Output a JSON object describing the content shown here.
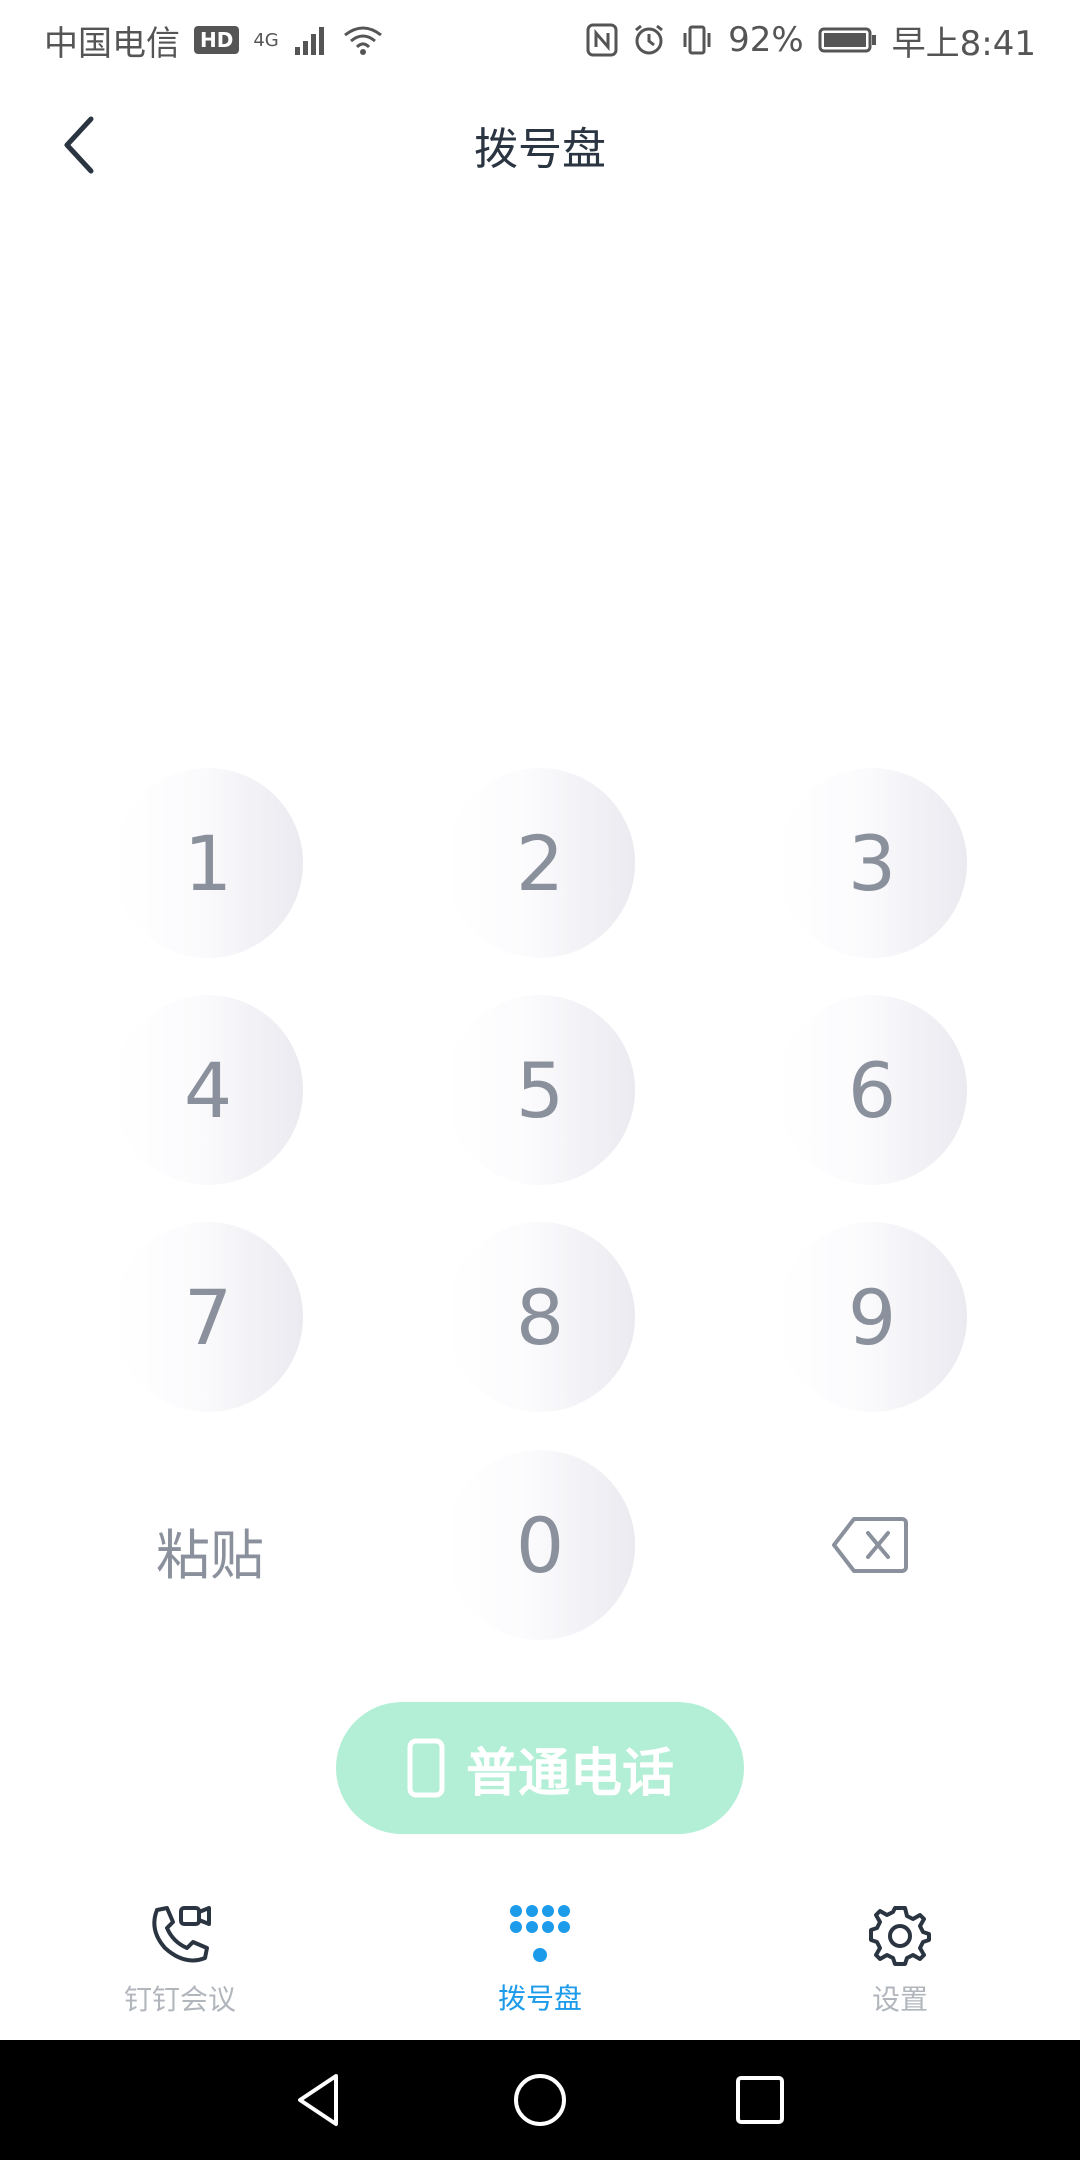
{
  "status_bar": {
    "carrier": "中国电信",
    "hd": "HD",
    "network": "4G",
    "battery": "92%",
    "time": "早上8:41"
  },
  "header": {
    "title": "拨号盘"
  },
  "keypad": {
    "keys": [
      "1",
      "2",
      "3",
      "4",
      "5",
      "6",
      "7",
      "8",
      "9",
      "0"
    ],
    "paste_label": "粘贴"
  },
  "call_button": {
    "label": "普通电话"
  },
  "tabs": [
    {
      "label": "钉钉会议",
      "icon": "video-call-icon",
      "active": false
    },
    {
      "label": "拨号盘",
      "icon": "dialpad-icon",
      "active": true
    },
    {
      "label": "设置",
      "icon": "gear-icon",
      "active": false
    }
  ],
  "colors": {
    "accent": "#1c9bea",
    "call_button_bg": "#b3eed6",
    "text_primary": "#2b3542",
    "text_secondary": "#8a919c"
  }
}
